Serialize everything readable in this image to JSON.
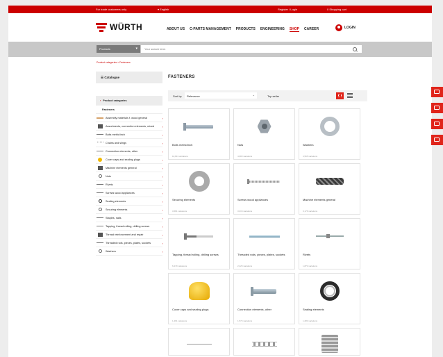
{
  "topbar": {
    "trade_customers": "For trade customers only",
    "language": "▾  English",
    "register_login": "Register / Login",
    "cart": "0  Shopping cart"
  },
  "header": {
    "logo": "WÜRTH",
    "nav": [
      "ABOUT US",
      "C-PARTS MANAGEMENT",
      "PRODUCTS",
      "ENGINEERING",
      "SHOP",
      "CAREER"
    ],
    "active_nav": "SHOP",
    "login": "LOGIN"
  },
  "search": {
    "category": "Products",
    "placeholder": "Your search term"
  },
  "breadcrumb": "Product categories > Fasteners",
  "sidebar": {
    "catalogue": "Catalogue",
    "product_categories": "Product categories",
    "current": "Fasteners",
    "items": [
      {
        "label": "Assembly materials f. wood general",
        "icon": "wood"
      },
      {
        "label": "Assortments, connection elements, mixed",
        "icon": "box"
      },
      {
        "label": "Bolts metric/inch",
        "icon": "rod"
      },
      {
        "label": "Chains and slings",
        "icon": "chain"
      },
      {
        "label": "Connection elements, other",
        "icon": "rod"
      },
      {
        "label": "Cover caps and sealing plugs",
        "icon": "cap"
      },
      {
        "label": "Machine elements general",
        "icon": "box"
      },
      {
        "label": "Nuts",
        "icon": "ring"
      },
      {
        "label": "Rivets",
        "icon": "rod"
      },
      {
        "label": "Screws wood appliances",
        "icon": "rod"
      },
      {
        "label": "Sealing elements",
        "icon": "ring-dark"
      },
      {
        "label": "Securing elements",
        "icon": "ring"
      },
      {
        "label": "Staples, nails",
        "icon": "rod"
      },
      {
        "label": "Tapping, thread rolling, drilling screws",
        "icon": "rod"
      },
      {
        "label": "Thread reinforcement and repair",
        "icon": "box"
      },
      {
        "label": "Threaded rods, pieces, plates, sockets",
        "icon": "rod"
      },
      {
        "label": "Washers",
        "icon": "ring"
      }
    ]
  },
  "content": {
    "title": "FASTENERS",
    "sort_label": "Sort by",
    "sort_value": "Relevance",
    "top_seller": "Top seller"
  },
  "products": [
    {
      "name": "Bolts metric/inch",
      "variations": "10,813 variations",
      "icon": "bolt-icon"
    },
    {
      "name": "Nuts",
      "variations": "4,983 variations",
      "icon": "nut-icon"
    },
    {
      "name": "Washers",
      "variations": "3,565 variations",
      "icon": "washer-icon"
    },
    {
      "name": "Securing elements",
      "variations": "3,681 variations",
      "icon": "securing-ring-icon"
    },
    {
      "name": "Screws wood appliances",
      "variations": "3,015 variations",
      "icon": "wood-screw-icon"
    },
    {
      "name": "Machine elements general",
      "variations": "6,176 variations",
      "icon": "spiral-pin-icon"
    },
    {
      "name": "Tapping, thread rolling, drilling screws",
      "variations": "6,279 variations",
      "icon": "drill-screw-icon"
    },
    {
      "name": "Threaded rods, pieces, plates, sockets",
      "variations": "2,225 variations",
      "icon": "threaded-rod-icon"
    },
    {
      "name": "Rivets",
      "variations": "1,873 variations",
      "icon": "rivet-icon"
    },
    {
      "name": "Cover caps and sealing plugs",
      "variations": "1,491 variations",
      "icon": "cover-cap-icon"
    },
    {
      "name": "Connection elements, other",
      "variations": "1,574 variations",
      "icon": "clevis-pin-icon"
    },
    {
      "name": "Sealing elements",
      "variations": "1,283 variations",
      "icon": "sealing-ring-icon"
    }
  ],
  "floating_icons": [
    "cart-icon",
    "mail-icon",
    "catalogue-icon",
    "graduation-icon"
  ]
}
